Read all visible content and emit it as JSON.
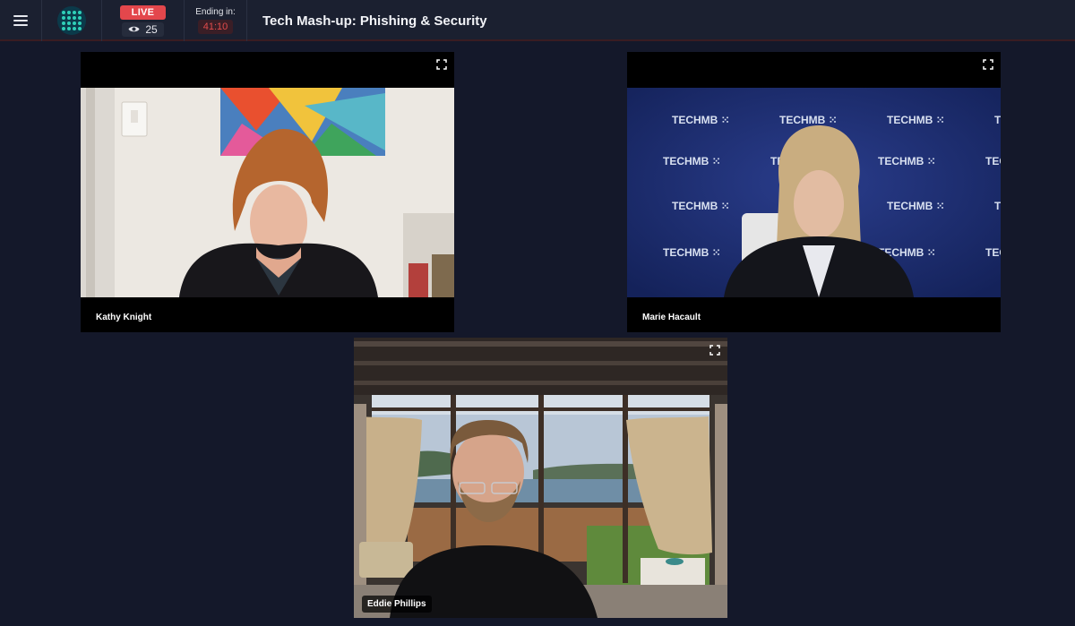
{
  "header": {
    "live_label": "LIVE",
    "viewer_count": "25",
    "ending_label": "Ending in:",
    "timer": "41:10",
    "title": "Tech Mash-up: Phishing & Security"
  },
  "participants": [
    {
      "name": "Kathy Knight"
    },
    {
      "name": "Marie Hacault"
    },
    {
      "name": "Eddie Phillips"
    }
  ],
  "backdrop": {
    "brand_text": "TECHMB"
  },
  "colors": {
    "background": "#14182a",
    "topbar": "#1b2030",
    "live": "#e3474c",
    "timer": "#e24b4b",
    "logo_dots": "#2fd0b8"
  }
}
